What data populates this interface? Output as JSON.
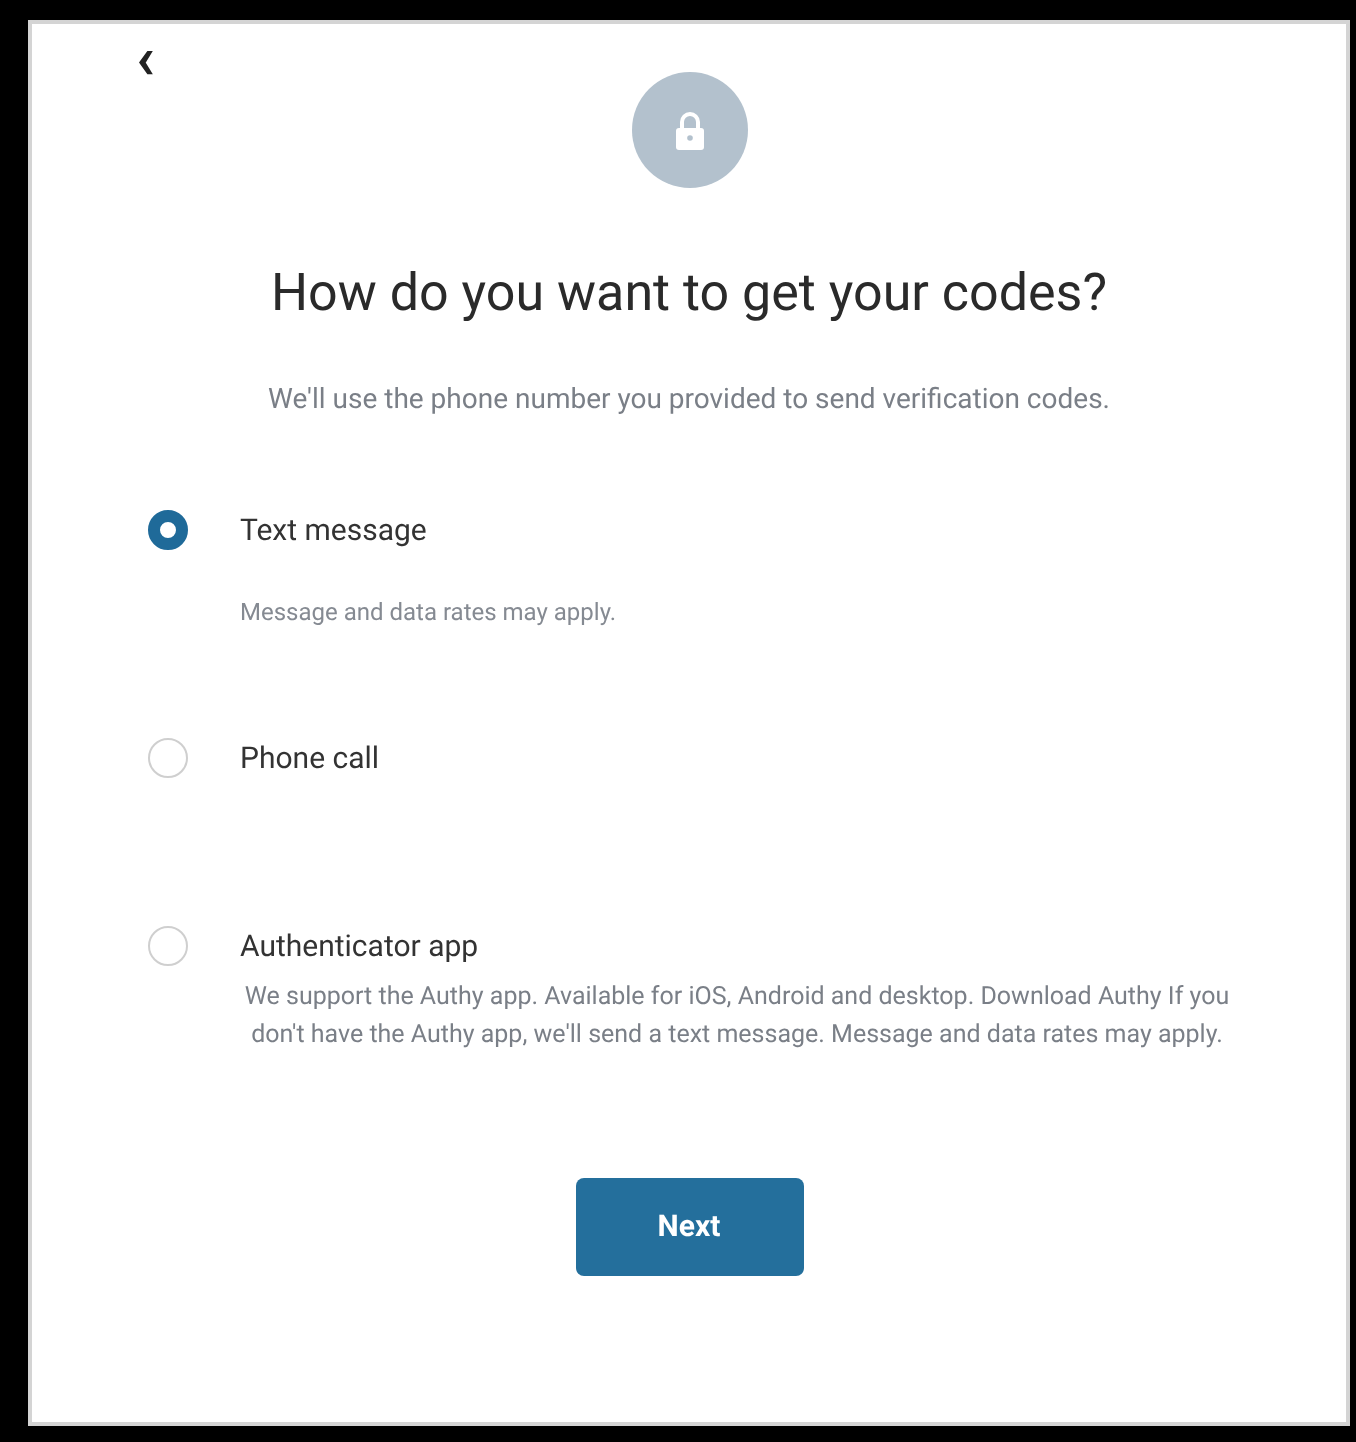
{
  "back_button": {
    "label": "‹"
  },
  "title": "How do you want to get your codes?",
  "subtitle": "We'll use the phone number you provided to send verification codes.",
  "options": [
    {
      "label": "Text message",
      "selected": true,
      "description": "Message and data rates may apply."
    },
    {
      "label": "Phone call",
      "selected": false
    },
    {
      "label": "Authenticator app",
      "selected": false,
      "description": "We support the Authy app. Available for iOS, Android and desktop. Download Authy If you don't have the Authy app, we'll send a text message. Message and data rates may apply."
    }
  ],
  "next_button": {
    "label": "Next"
  }
}
